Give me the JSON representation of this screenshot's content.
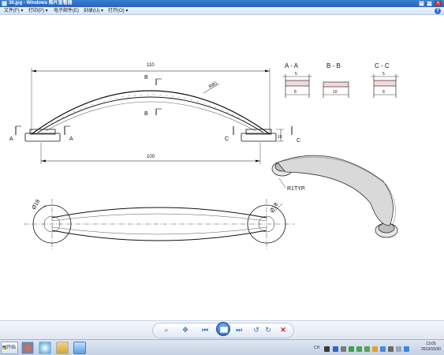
{
  "window": {
    "title": "38.jpg - Windows 照片查看器"
  },
  "menu": {
    "items": [
      "文件(F) ▾",
      "打印(P) ▾",
      "电子邮件(E)",
      "刻录(U) ▾",
      "打开(O) ▾"
    ],
    "help_icon": "help-icon"
  },
  "drawing": {
    "section_titles": [
      "A - A",
      "B - B",
      "C - C"
    ],
    "section_dims": [
      "5",
      "8",
      "10",
      "5",
      "8"
    ],
    "overall_width": "110",
    "base_width": "100",
    "radius_label": "R80",
    "height_label": "10",
    "section_markers": [
      "A",
      "A",
      "B",
      "B",
      "C",
      "C"
    ],
    "diameter_left": "Ø18",
    "diameter_right": "Ø18",
    "fillet_label": "R1TYP."
  },
  "toolbar": {
    "icons": [
      "zoom-icon",
      "fit-icon",
      "previous-icon",
      "slideshow-icon",
      "next-icon",
      "rotate-left-icon",
      "rotate-right-icon",
      "delete-icon"
    ]
  },
  "taskbar": {
    "start_label": "开始",
    "tray_label": "CH",
    "time": "13:05",
    "date": "2013/10/30"
  }
}
